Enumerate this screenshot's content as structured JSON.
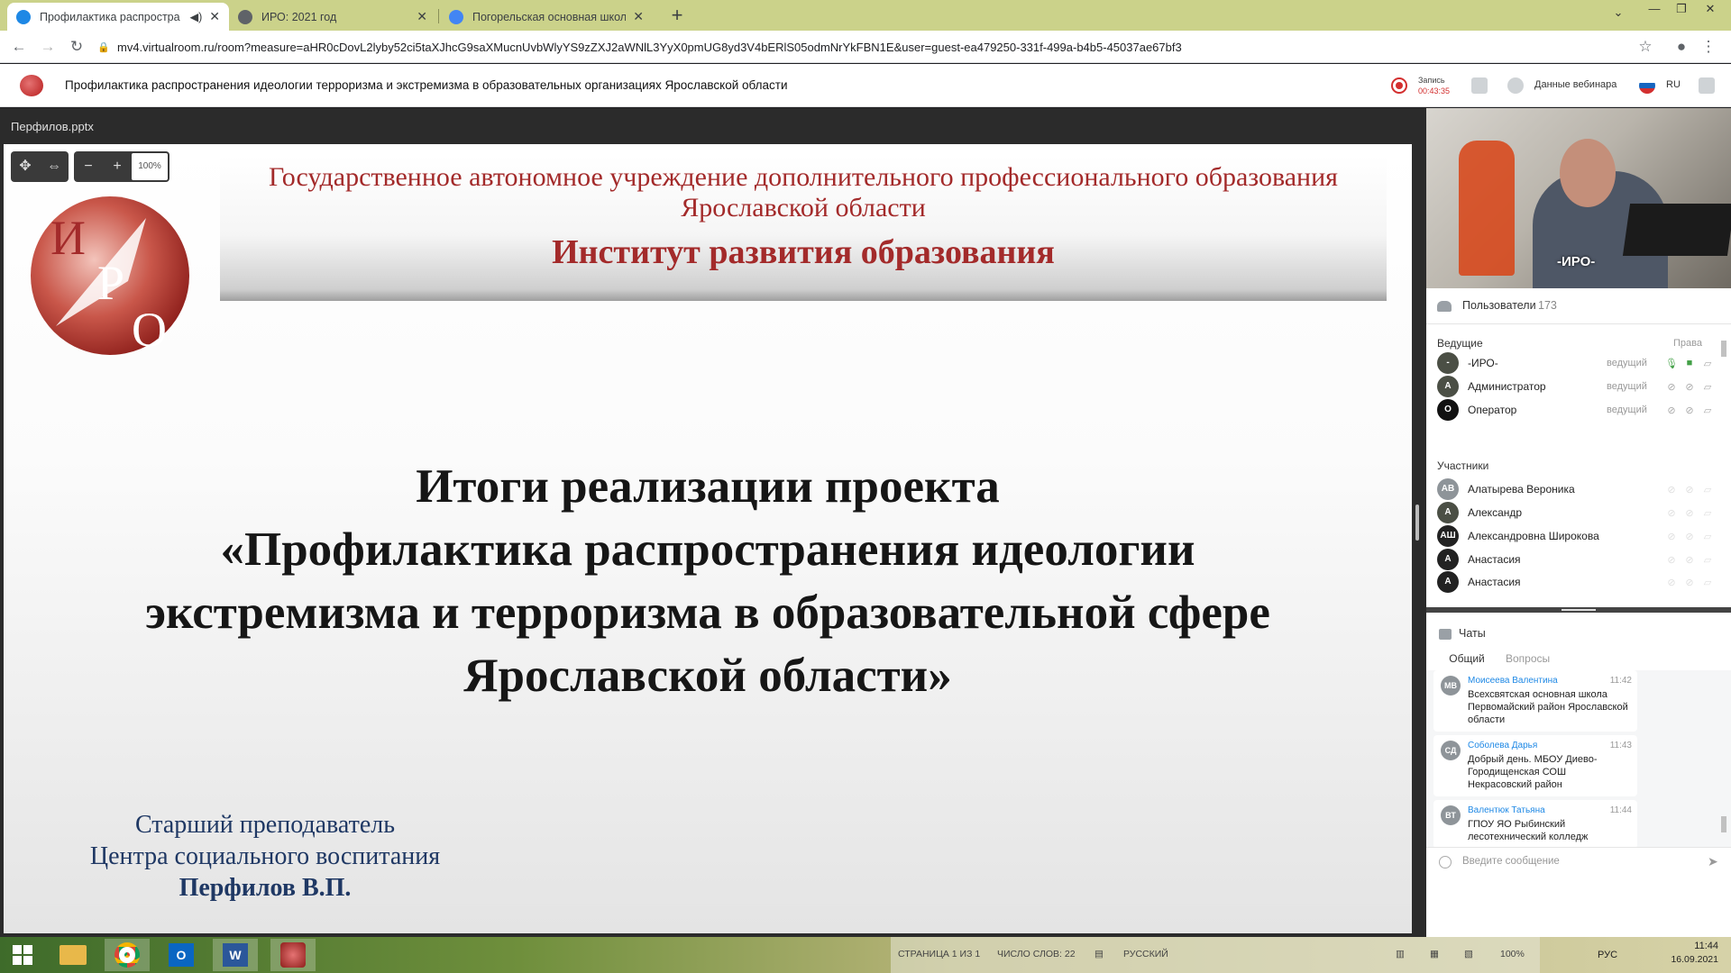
{
  "browser": {
    "tabs": [
      {
        "title": "Профилактика распростра",
        "favicon_color": "#1e88e5"
      },
      {
        "title": "ИРО: 2021 год",
        "favicon_color": "#5f6368"
      },
      {
        "title": "Погорельская основная школа",
        "favicon_color": "#4285f4"
      }
    ],
    "new_tab_label": "+",
    "url": "mv4.virtualroom.ru/room?measure=aHR0cDovL2lyby52ci5taXJhcG9saXMucnUvbWlyYS9zZXJ2aWNlL3YyX0pmUG8yd3V4bERlS05odmNrYkFBN1E&user=guest-ea479250-331f-499a-b4b5-45037ae67bf3"
  },
  "webinar": {
    "title": "Профилактика распространения идеологии терроризма и экстремизма в образовательных организациях Ярославской области",
    "record_label": "Запись",
    "record_time": "00:43:35",
    "details_label": "Данные вебинара",
    "language": "RU"
  },
  "presentation": {
    "filename": "Перфилов.pptx",
    "zoom": "100%",
    "slide": {
      "logo_letters": [
        "И",
        "Р",
        "О"
      ],
      "org_line1": "Государственное автономное учреждение дополнительного профессионального образования",
      "org_line2": "Ярославской области",
      "org_name": "Институт развития образования",
      "title_lines": [
        "Итоги реализации проекта",
        "«Профилактика распространения идеологии",
        "экстремизма и терроризма в образовательной сфере",
        "Ярославской области»"
      ],
      "author_role1": "Старший преподаватель",
      "author_role2": "Центра социального воспитания",
      "author_name": "Перфилов В.П."
    }
  },
  "video": {
    "label": "-ИРО-"
  },
  "users": {
    "header": "Пользователи",
    "count": "173",
    "hosts_label": "Ведущие",
    "rights_label": "Права",
    "participants_label": "Участники",
    "hosts": [
      {
        "initials": "-",
        "name": "-ИРО-",
        "role": "ведущий",
        "color": "#4b4f45"
      },
      {
        "initials": "А",
        "name": "Администратор",
        "role": "ведущий",
        "color": "#4b4f45"
      },
      {
        "initials": "О",
        "name": "Оператор",
        "role": "ведущий",
        "color": "#111111"
      }
    ],
    "participants": [
      {
        "initials": "АВ",
        "name": "Алатырева Вероника",
        "color": "#8e9499"
      },
      {
        "initials": "А",
        "name": "Александр",
        "color": "#4b4f45"
      },
      {
        "initials": "АШ",
        "name": "Александровна Широкова",
        "color": "#222222"
      },
      {
        "initials": "А",
        "name": "Анастасия",
        "color": "#222222"
      },
      {
        "initials": "А",
        "name": "Анастасия",
        "color": "#222222"
      }
    ]
  },
  "chat": {
    "header": "Чаты",
    "tab_common": "Общий",
    "tab_questions": "Вопросы",
    "messages": [
      {
        "initials": "МВ",
        "author": "Моисеева Валентина",
        "time": "11:42",
        "text": "Всехсвятская основная школа Первомайский район Ярославской области"
      },
      {
        "initials": "СД",
        "author": "Соболева Дарья",
        "time": "11:43",
        "text": "Добрый день. МБОУ Диево-Городищенская СОШ Некрасовский район"
      },
      {
        "initials": "ВТ",
        "author": "Валентюк Татьяна",
        "time": "11:44",
        "text": "ГПОУ ЯО Рыбинский лесотехнический колледж"
      }
    ],
    "input_placeholder": "Введите сообщение"
  },
  "taskbar": {
    "word_status": {
      "page": "СТРАНИЦА 1 ИЗ 1",
      "words": "ЧИСЛО СЛОВ: 22",
      "language": "РУССКИЙ",
      "zoom": "100%"
    },
    "keyboard": "РУС",
    "time": "11:44",
    "date": "16.09.2021"
  }
}
